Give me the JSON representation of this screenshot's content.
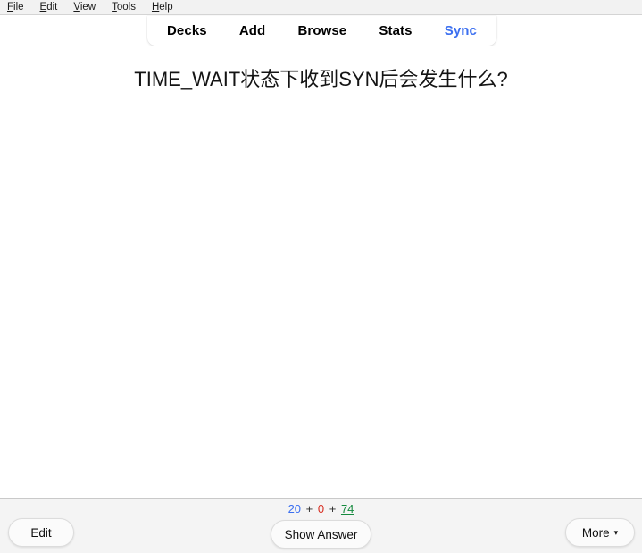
{
  "menubar": {
    "items": [
      {
        "label": "File",
        "mnemonic": "F",
        "rest": "ile"
      },
      {
        "label": "Edit",
        "mnemonic": "E",
        "rest": "dit"
      },
      {
        "label": "View",
        "mnemonic": "V",
        "rest": "iew"
      },
      {
        "label": "Tools",
        "mnemonic": "T",
        "rest": "ools"
      },
      {
        "label": "Help",
        "mnemonic": "H",
        "rest": "elp"
      }
    ]
  },
  "toolbar": {
    "tabs": [
      {
        "label": "Decks",
        "active": false
      },
      {
        "label": "Add",
        "active": false
      },
      {
        "label": "Browse",
        "active": false
      },
      {
        "label": "Stats",
        "active": false
      },
      {
        "label": "Sync",
        "active": true
      }
    ],
    "accent_color": "#3b6ff0"
  },
  "card": {
    "question": "TIME_WAIT状态下收到SYN后会发生什么?"
  },
  "counts": {
    "new": "20",
    "separator1": "+",
    "learning": "0",
    "separator2": "+",
    "due": "74",
    "new_color": "#3b6ff0",
    "learning_color": "#d72d20",
    "due_color": "#158a3e"
  },
  "buttons": {
    "edit": "Edit",
    "show_answer": "Show Answer",
    "more": "More",
    "more_caret": "▾"
  }
}
